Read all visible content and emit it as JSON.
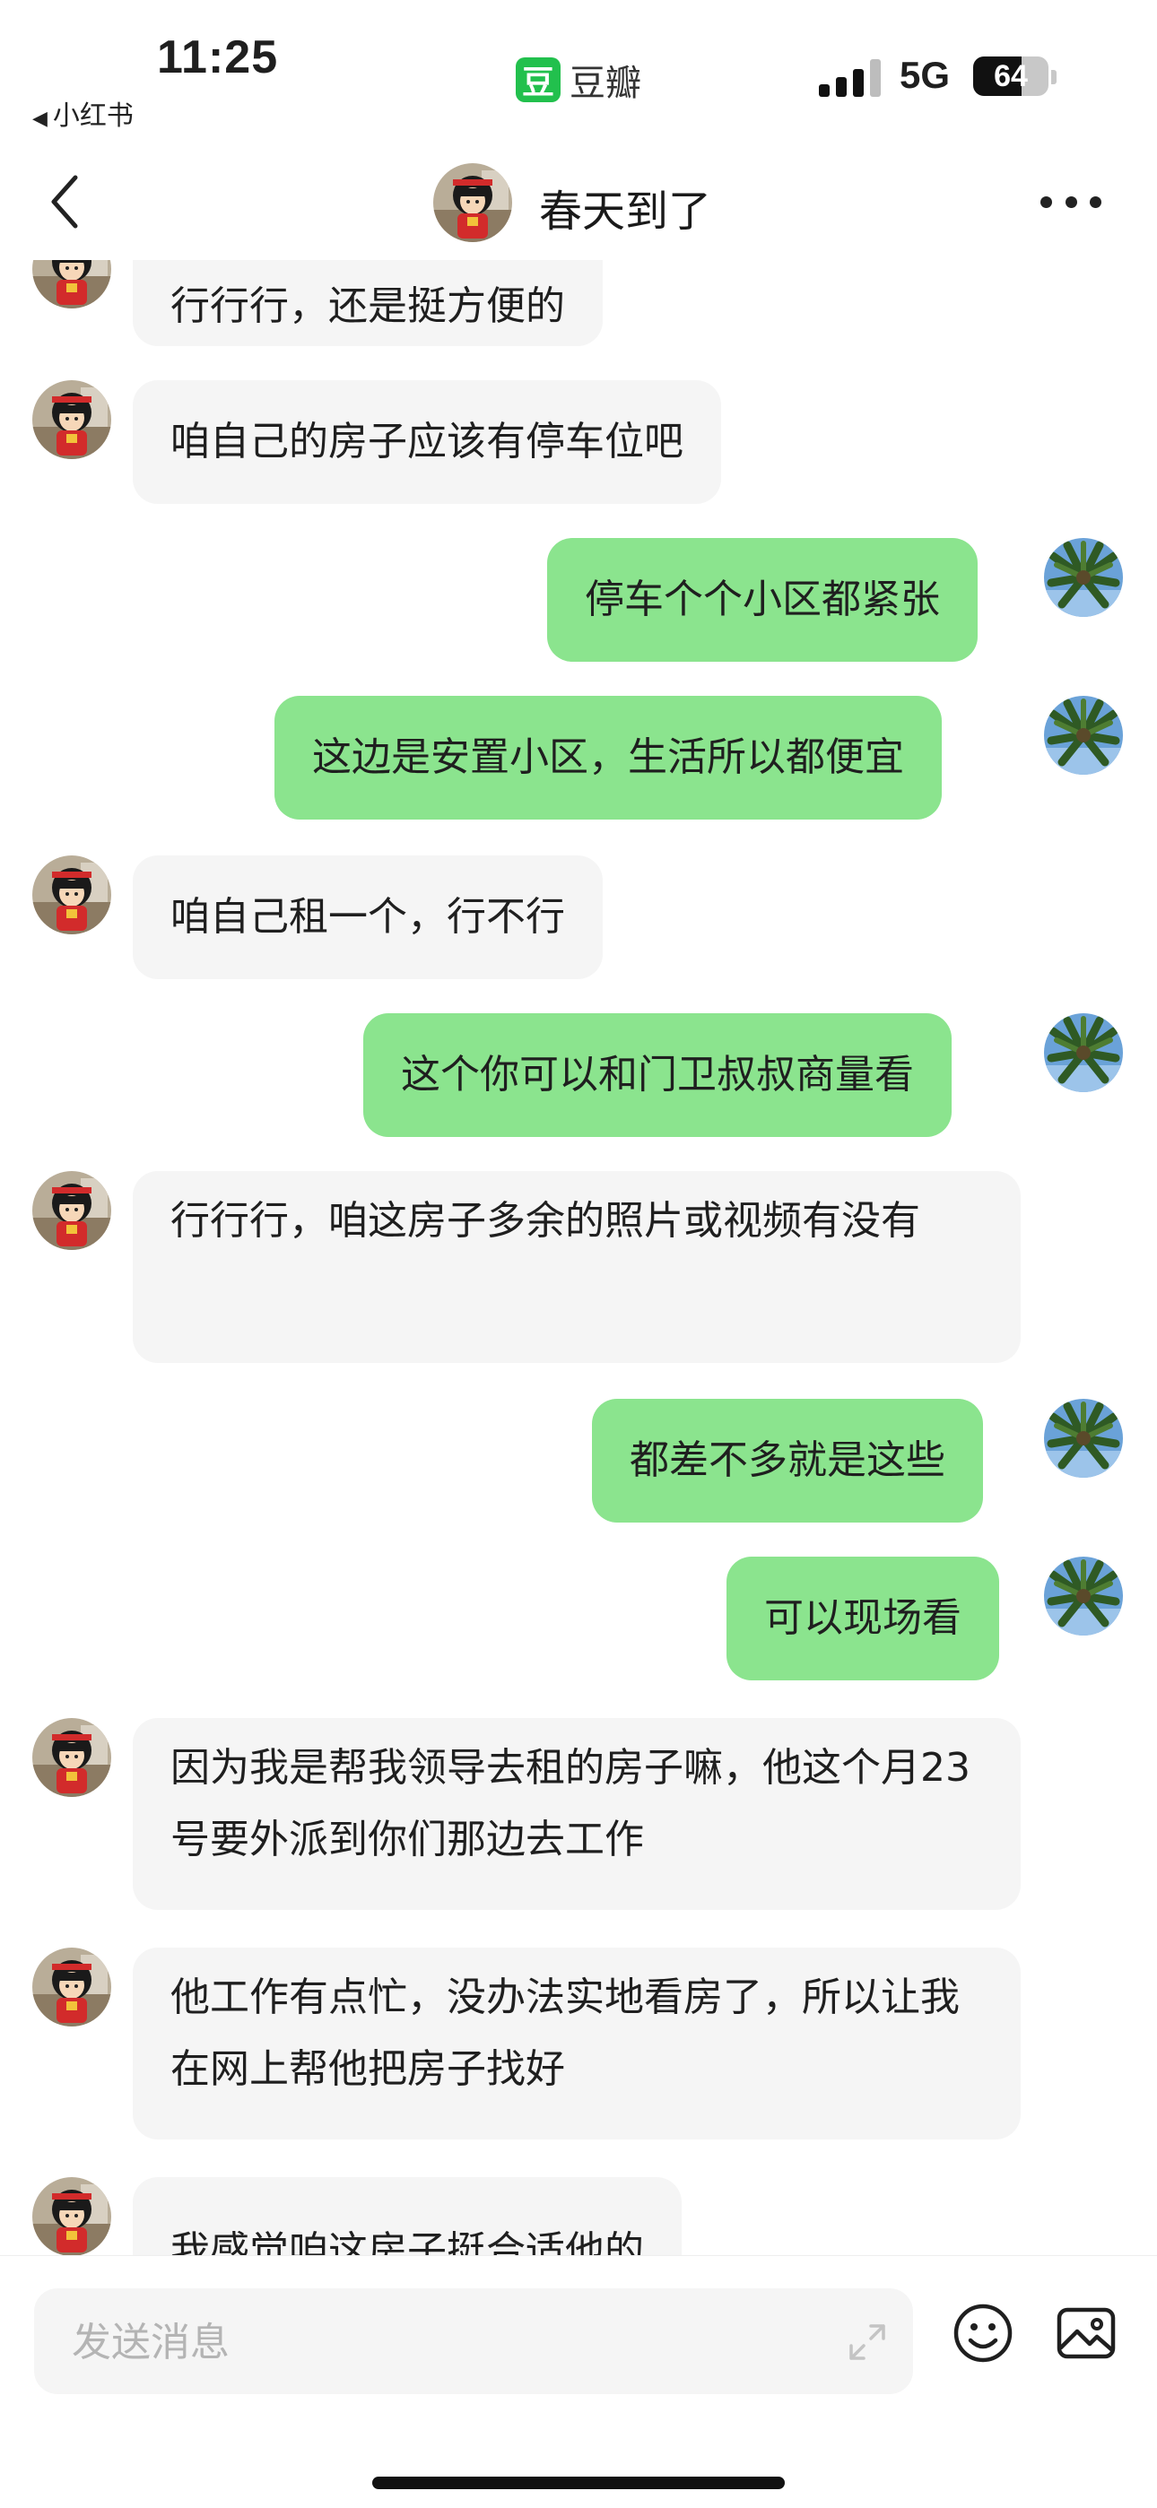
{
  "status_bar": {
    "time": "11:25",
    "back_app": "小红书",
    "center_app_logo": "豆",
    "center_app_name": "豆瓣",
    "network": "5G",
    "battery": "64",
    "battery_level": 0.64
  },
  "nav": {
    "title": "春天到了",
    "back_icon": "chevron-left-icon",
    "more_icon": "more-dots-icon"
  },
  "messages": [
    {
      "side": "in",
      "text": "行行行，还是挺方便的"
    },
    {
      "side": "in",
      "text": "咱自己的房子应该有停车位吧"
    },
    {
      "side": "out",
      "text": "停车个个小区都紧张"
    },
    {
      "side": "out",
      "text": "这边是安置小区，生活所以都便宜"
    },
    {
      "side": "in",
      "text": "咱自己租一个，行不行"
    },
    {
      "side": "out",
      "text": "这个你可以和门卫叔叔商量看"
    },
    {
      "side": "in",
      "text": "行行行，咱这房子多余的照片或视频有没有"
    },
    {
      "side": "out",
      "text": "都差不多就是这些"
    },
    {
      "side": "out",
      "text": "可以现场看"
    },
    {
      "side": "in",
      "text": "因为我是帮我领导去租的房子嘛，他这个月23号要外派到你们那边去工作"
    },
    {
      "side": "in",
      "text": "他工作有点忙，没办法实地看房了，所以让我在网上帮他把房子找好"
    },
    {
      "side": "in",
      "text": "我感觉咱这房子挺合适他的"
    }
  ],
  "input": {
    "placeholder": "发送消息"
  },
  "colors": {
    "outgoing_bubble": "#8be48e",
    "incoming_bubble": "#f5f5f5",
    "brand_green": "#22c04d"
  }
}
